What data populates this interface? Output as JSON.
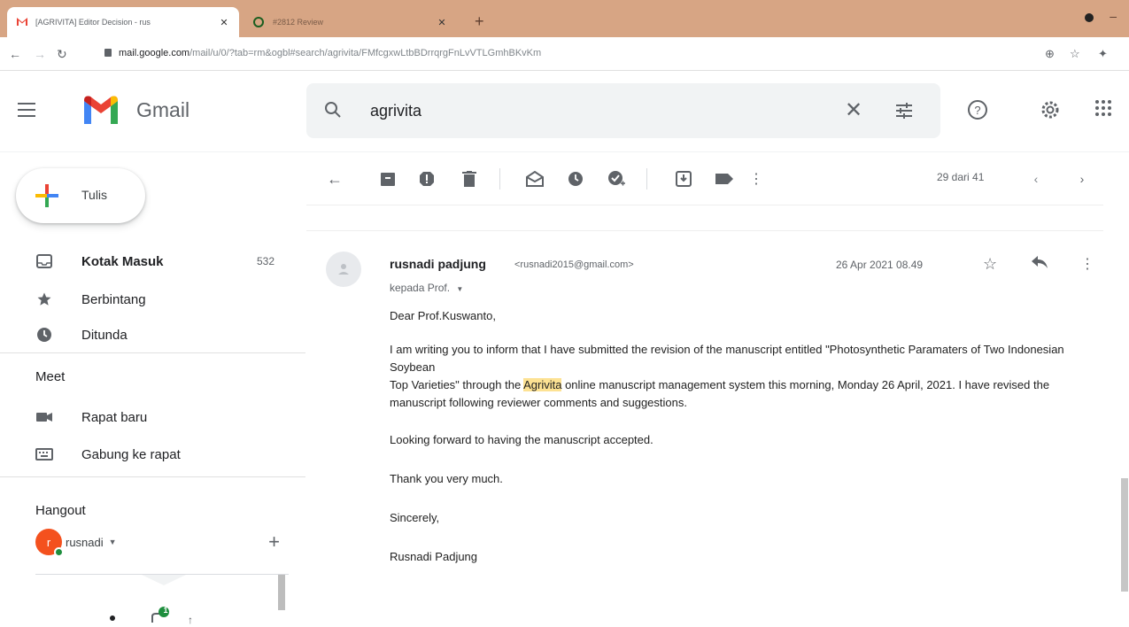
{
  "browser": {
    "tabs": [
      {
        "title": "[AGRIVITA] Editor Decision - rus",
        "active": true
      },
      {
        "title": "#2812 Review",
        "active": false
      }
    ],
    "url_domain": "mail.google.com",
    "url_rest": "/mail/u/0/?tab=rm&ogbl#search/agrivita/FMfcgxwLtbBDrrqrgFnLvVTLGmhBKvKm"
  },
  "header": {
    "app_name": "Gmail",
    "search_value": "agrivita"
  },
  "sidebar": {
    "compose_label": "Tulis",
    "items": [
      {
        "label": "Kotak Masuk",
        "count": "532",
        "icon": "inbox-icon"
      },
      {
        "label": "Berbintang",
        "count": "",
        "icon": "star-icon"
      },
      {
        "label": "Ditunda",
        "count": "",
        "icon": "clock-icon"
      }
    ],
    "meet": {
      "title": "Meet",
      "items": [
        {
          "label": "Rapat baru",
          "icon": "video-icon"
        },
        {
          "label": "Gabung ke rapat",
          "icon": "keyboard-icon"
        }
      ]
    },
    "hangout": {
      "title": "Hangout",
      "user": "rusnadi",
      "avatar_letter": "r",
      "badge": "1"
    }
  },
  "toolbar": {
    "pager": "29 dari 41"
  },
  "message": {
    "sender_name": "rusnadi padjung",
    "sender_email": "<rusnadi2015@gmail.com>",
    "to": "kepada Prof.",
    "date": "26 Apr 2021 08.49",
    "greeting": "Dear Prof.Kuswanto,",
    "para1_a": "I am writing you to inform that I have submitted the revision of the manuscript entitled \"Photosynthetic Paramaters of Two Indonesian Soybean",
    "para1_b": "Top Varieties\" through the ",
    "highlight": "Agrivita",
    "para1_c": " online manuscript management system this morning, Monday 26 April, 2021. I have revised the manuscript  following reviewer comments and suggestions.",
    "para2": "Looking forward to having the manuscript accepted.",
    "para3": "Thank you very much.",
    "para4": "Sincerely,",
    "signature": "Rusnadi Padjung"
  },
  "colors": {
    "tabstrip": "#d7a584",
    "highlight": "#fde293",
    "avatar": "#f4511e"
  }
}
